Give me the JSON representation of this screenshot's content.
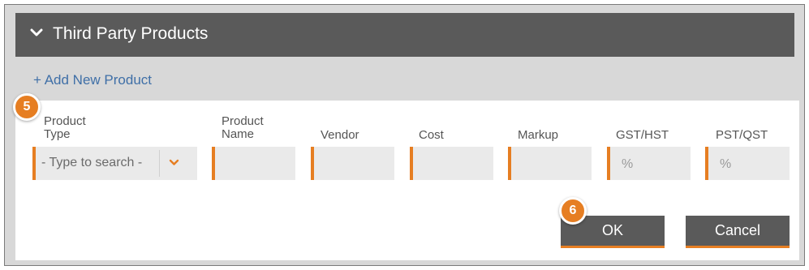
{
  "section": {
    "title": "Third Party Products"
  },
  "add_product_link": "+ Add New Product",
  "columns": {
    "product_type": "Product\nType",
    "product_name": "Product\nName",
    "vendor": "Vendor",
    "cost": "Cost",
    "markup": "Markup",
    "gst_hst": "GST/HST",
    "pst_qst": "PST/QST"
  },
  "fields": {
    "product_type_value": "- Type to search -",
    "product_name_value": "",
    "vendor_value": "",
    "cost_value": "",
    "markup_value": "",
    "gst_hst_unit": "%",
    "pst_qst_unit": "%"
  },
  "buttons": {
    "ok": "OK",
    "cancel": "Cancel"
  },
  "badges": {
    "step5": "5",
    "step6": "6"
  },
  "colors": {
    "accent": "#e67e22",
    "header_bg": "#5a5a5a",
    "link": "#3f6fa7"
  },
  "icons": {
    "section_toggle": "chevron-down-icon",
    "select_toggle": "chevron-down-icon"
  }
}
